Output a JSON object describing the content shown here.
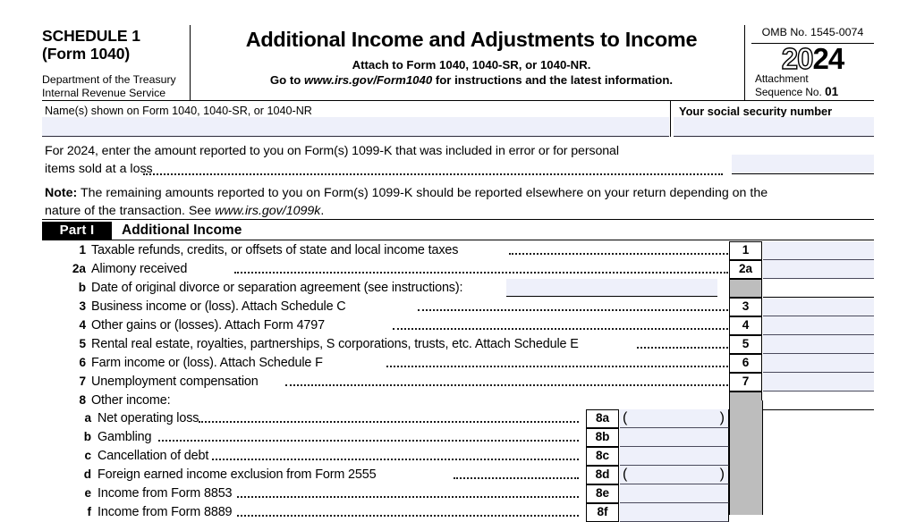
{
  "form": {
    "schedule_title_line1": "SCHEDULE 1",
    "schedule_title_line2": "(Form 1040)",
    "department_line1": "Department of the Treasury",
    "department_line2": "Internal Revenue Service",
    "main_title": "Additional Income and Adjustments to Income",
    "attach_line": "Attach to Form 1040, 1040-SR, or 1040-NR.",
    "goto_prefix": "Go to ",
    "goto_url": "www.irs.gov/Form1040",
    "goto_suffix": " for instructions and the latest information.",
    "omb_number": "OMB No. 1545-0074",
    "year_outline": "20",
    "year_solid": "24",
    "attachment_label_line1": "Attachment",
    "attachment_label_line2": "Sequence No.",
    "attachment_sequence": "01"
  },
  "identity": {
    "name_label": "Name(s) shown on Form 1040, 1040-SR, or 1040-NR",
    "name_value": "",
    "ssn_label": "Your social security number",
    "ssn_value": ""
  },
  "k_block": {
    "line1": "For 2024, enter the amount reported to you on Form(s) 1099-K that was included in error or for personal",
    "line2": "items sold at a loss",
    "amount_value": "",
    "note_bold": "Note:",
    "note_text_1": " The remaining amounts reported to you on Form(s) 1099-K should be reported elsewhere on your return depending on the",
    "note_text_2": "nature of the transaction. See ",
    "note_url": "www.irs.gov/1099k",
    "note_end": "."
  },
  "part1": {
    "tag": "Part I",
    "name": "Additional Income"
  },
  "lines": [
    {
      "num": "1",
      "text": "Taxable refunds, credits, or offsets of state and local income taxes",
      "box": "1",
      "boxed": true,
      "shaded": false,
      "value": ""
    },
    {
      "num": "2a",
      "text": "Alimony received",
      "box": "2a",
      "boxed": true,
      "shaded": false,
      "value": ""
    },
    {
      "num": "b",
      "text": "Date of original divorce or separation agreement (see instructions):",
      "box": "",
      "boxed": true,
      "shaded": true,
      "value": "",
      "date_value": ""
    },
    {
      "num": "3",
      "text": "Business income or (loss). Attach Schedule C",
      "box": "3",
      "boxed": true,
      "shaded": false,
      "value": ""
    },
    {
      "num": "4",
      "text": "Other gains or (losses). Attach Form 4797",
      "box": "4",
      "boxed": true,
      "shaded": false,
      "value": ""
    },
    {
      "num": "5",
      "text": "Rental real estate, royalties, partnerships, S corporations, trusts, etc. Attach Schedule E",
      "box": "5",
      "boxed": true,
      "shaded": false,
      "value": ""
    },
    {
      "num": "6",
      "text": "Farm income or (loss). Attach Schedule F",
      "box": "6",
      "boxed": true,
      "shaded": false,
      "value": ""
    },
    {
      "num": "7",
      "text": "Unemployment compensation",
      "box": "7",
      "boxed": true,
      "shaded": false,
      "value": ""
    },
    {
      "num": "8",
      "text": "Other income:",
      "box": "",
      "boxed": false,
      "shaded": true,
      "value": ""
    }
  ],
  "sublines_8": [
    {
      "num": "a",
      "text": "Net operating loss",
      "box": "8a",
      "paren": true,
      "value": ""
    },
    {
      "num": "b",
      "text": "Gambling",
      "box": "8b",
      "paren": false,
      "value": ""
    },
    {
      "num": "c",
      "text": "Cancellation of debt",
      "box": "8c",
      "paren": false,
      "value": ""
    },
    {
      "num": "d",
      "text": "Foreign earned income exclusion from Form 2555",
      "box": "8d",
      "paren": true,
      "value": ""
    },
    {
      "num": "e",
      "text": "Income from Form 8853",
      "box": "8e",
      "paren": false,
      "value": ""
    },
    {
      "num": "f",
      "text": "Income from Form 8889",
      "box": "8f",
      "paren": false,
      "value": ""
    }
  ],
  "colors": {
    "field_fill": "#eef0fa",
    "shaded_box": "#bdbdbd",
    "rule": "#000000"
  }
}
